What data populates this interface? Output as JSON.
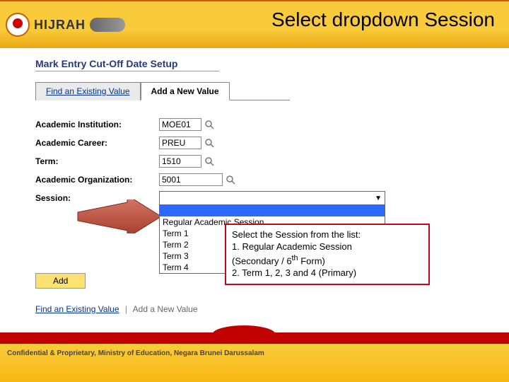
{
  "brand": {
    "name": "HIJRAH"
  },
  "slide": {
    "title": "Select dropdown Session"
  },
  "page": {
    "title": "Mark Entry Cut-Off Date Setup"
  },
  "tabs": {
    "find": "Find an Existing Value",
    "add": "Add a New Value"
  },
  "form": {
    "labels": {
      "institution": "Academic Institution:",
      "career": "Academic Career:",
      "term": "Term:",
      "org": "Academic Organization:",
      "session": "Session:"
    },
    "values": {
      "institution": "MOE01",
      "career": "PREU",
      "term": "1510",
      "org": "5001"
    },
    "session_options": {
      "o0": "",
      "o1": "Regular Academic Session",
      "o2": "Term 1",
      "o3": "Term 2",
      "o4": "Term 3",
      "o5": "Term 4"
    }
  },
  "buttons": {
    "add": "Add"
  },
  "callout": {
    "l1": "Select the Session from the list:",
    "l2": "1.  Regular Academic Session",
    "l3": "     (Secondary / 6",
    "l3sup": "th",
    "l3b": " Form)",
    "l4": "2. Term 1, 2, 3 and 4 (Primary)"
  },
  "bottomlinks": {
    "find": "Find an Existing Value",
    "add": "Add a New Value"
  },
  "footer": {
    "text": "Confidential & Proprietary, Ministry of Education, Negara Brunei Darussalam"
  }
}
